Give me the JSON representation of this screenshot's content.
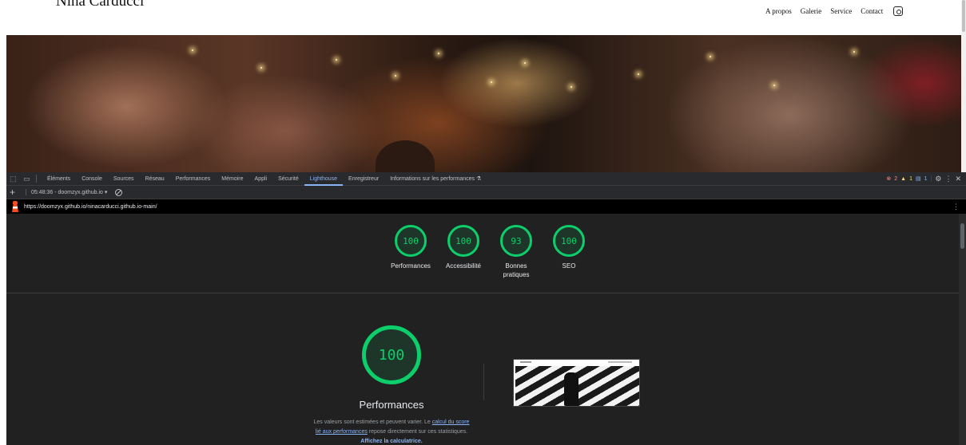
{
  "site": {
    "logo": "Nina Carducci",
    "nav": [
      "A propos",
      "Galerie",
      "Service",
      "Contact"
    ],
    "instagram_icon": "instagram-icon"
  },
  "devtools": {
    "tabs": [
      "Éléments",
      "Console",
      "Sources",
      "Réseau",
      "Performances",
      "Mémoire",
      "Appli",
      "Sécurité",
      "Lighthouse",
      "Enregistreur",
      "Informations sur les performances ⚗"
    ],
    "active_tab": "Lighthouse",
    "errors": "2",
    "warnings": "1",
    "info": "1",
    "report_select": "05:48:36 - doomzyx.github.io ▾",
    "url": "https://doomzyx.github.io/ninacarducci.github.io-main/"
  },
  "report": {
    "gauges": [
      {
        "score": "100",
        "label": "Performances"
      },
      {
        "score": "100",
        "label": "Accessibilité"
      },
      {
        "score": "93",
        "label": "Bonnes pratiques"
      },
      {
        "score": "100",
        "label": "SEO"
      }
    ],
    "main_score": "100",
    "main_title": "Performances",
    "desc_before": "Les valeurs sont estimées et peuvent varier. Le ",
    "desc_link1": "calcul du score lié aux performances",
    "desc_middle": " repose directement sur ces statistiques. ",
    "desc_link2": "Affichez la calculatrice."
  },
  "colors": {
    "score_good": "#0cce6b",
    "accent_link": "#8ab4f8",
    "devtools_bg": "#202124",
    "error": "#f28b82",
    "warning": "#fdd663"
  }
}
